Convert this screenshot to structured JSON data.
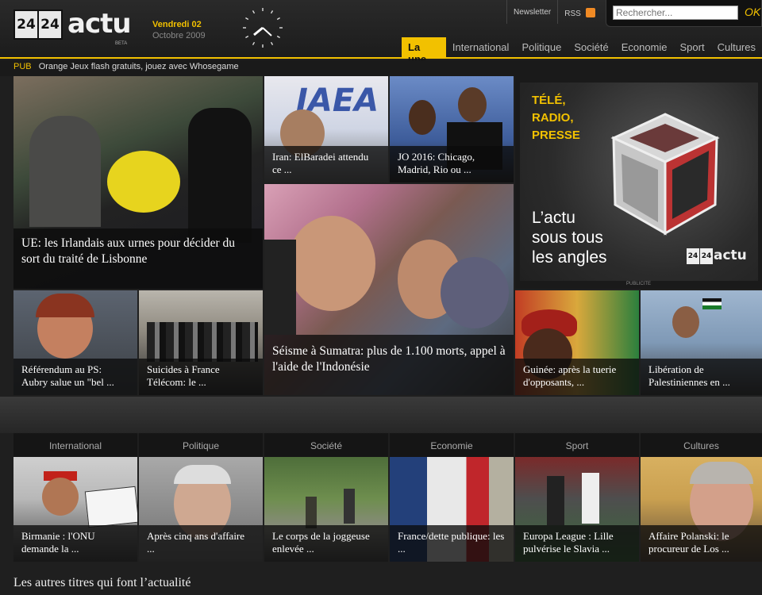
{
  "header": {
    "logo_num1": "24",
    "logo_num2": "24",
    "logo_word": "actu",
    "logo_beta": "BETA",
    "date_day": "Vendredi 02",
    "date_month": "Octobre 2009",
    "links": {
      "newsletter": "Newsletter",
      "rss": "RSS"
    },
    "search_placeholder": "Rechercher...",
    "search_ok": "OK"
  },
  "nav": [
    "La une",
    "International",
    "Politique",
    "Société",
    "Economie",
    "Sport",
    "Cultures"
  ],
  "pub": {
    "label": "PUB",
    "text": "Orange Jeux flash gratuits, jouez avec Whosegame"
  },
  "tiles": {
    "main": "UE: les Irlandais aux urnes pour décider du sort du traité de Lisbonne",
    "iran": "Iran: ElBaradei attendu ce ...",
    "jo": "JO 2016: Chicago, Madrid, Rio ou ...",
    "sumatra": "Séisme à Sumatra: plus de 1.100 morts, appel à l'aide de l'Indonésie",
    "referendum": "Référendum au PS: Aubry salue un \"bel ...",
    "suicides": "Suicides à France Télécom: le ...",
    "guinee": "Guinée: après la tuerie d'opposants, ...",
    "liberation": "Libération de Palestiniennes en ..."
  },
  "ad": {
    "line1": "TÉLÉ,",
    "line2": "RADIO,",
    "line3": "PRESSE",
    "tag1": "L’actu",
    "tag2": "sous tous",
    "tag3": "les angles",
    "brand": "actu",
    "brand_num1": "24",
    "brand_num2": "24",
    "note": "PUBLICITE"
  },
  "categories": [
    {
      "title": "International",
      "headline": "Birmanie : l'ONU demande la ..."
    },
    {
      "title": "Politique",
      "headline": "Après cinq ans d'affaire ..."
    },
    {
      "title": "Société",
      "headline": "Le corps de la joggeuse enlevée ..."
    },
    {
      "title": "Economie",
      "headline": "France/dette publique: les ..."
    },
    {
      "title": "Sport",
      "headline": "Europa League : Lille pulvérise le Slavia ..."
    },
    {
      "title": "Cultures",
      "headline": "Affaire Polanski: le procureur de Los ..."
    }
  ],
  "others_title": "Les autres titres qui font l’actualité"
}
